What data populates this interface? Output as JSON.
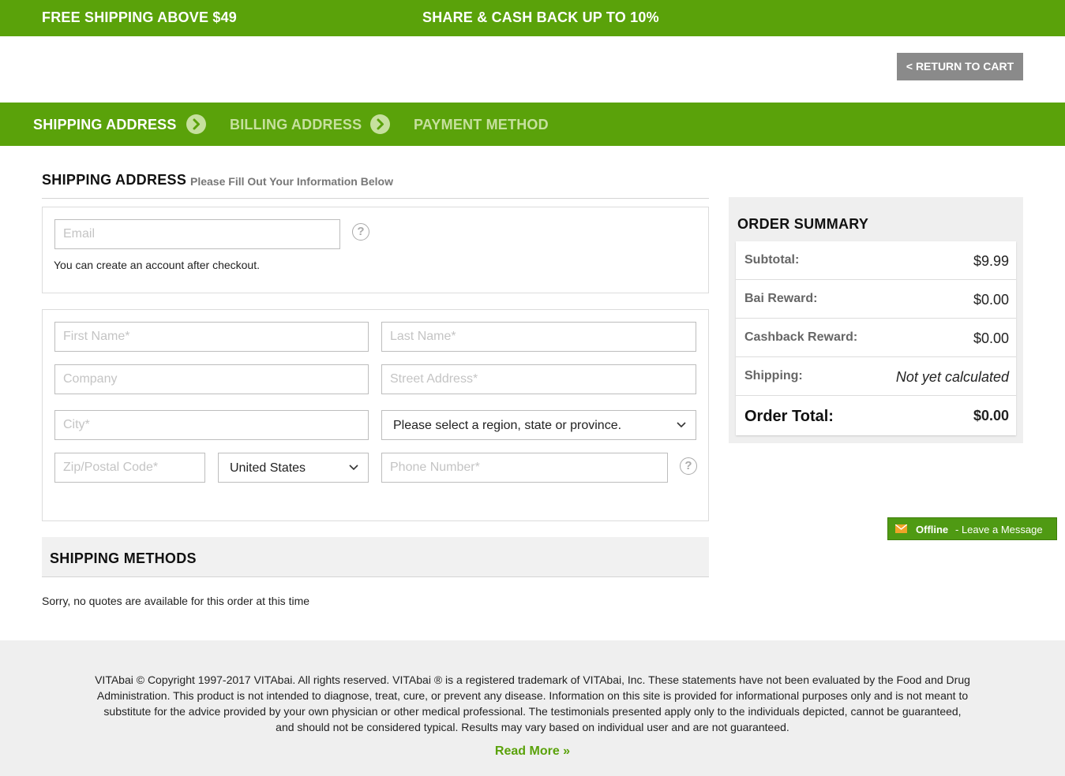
{
  "promo": {
    "left": "FREE SHIPPING ABOVE $49",
    "right": "SHARE & CASH BACK UP TO 10%"
  },
  "header": {
    "return_label": "< RETURN TO CART"
  },
  "steps": [
    {
      "label": "SHIPPING ADDRESS",
      "active": true
    },
    {
      "label": "BILLING ADDRESS",
      "active": false
    },
    {
      "label": "PAYMENT METHOD",
      "active": false
    }
  ],
  "shipping": {
    "title": "SHIPPING ADDRESS",
    "subtitle": "Please Fill Out Your Information Below",
    "email_placeholder": "Email",
    "account_note": "You can create an account after checkout.",
    "first_name_placeholder": "First Name*",
    "last_name_placeholder": "Last Name*",
    "company_placeholder": "Company",
    "street_placeholder": "Street Address*",
    "city_placeholder": "City*",
    "region_selected": "Please select a region, state or province.",
    "zip_placeholder": "Zip/Postal Code*",
    "country_selected": "United States",
    "phone_placeholder": "Phone Number*",
    "help_glyph": "?"
  },
  "shipping_methods": {
    "title": "SHIPPING METHODS",
    "message": "Sorry, no quotes are available for this order at this time"
  },
  "summary": {
    "title": "ORDER SUMMARY",
    "rows": [
      {
        "label": "Subtotal:",
        "value": "$9.99"
      },
      {
        "label": "Bai Reward:",
        "value": "$0.00"
      },
      {
        "label": "Cashback Reward:",
        "value": "$0.00"
      },
      {
        "label": "Shipping:",
        "value": "Not yet calculated"
      },
      {
        "label": "Order Total:",
        "value": "$0.00"
      }
    ]
  },
  "chat": {
    "status": "Offline",
    "message": "- Leave a Message"
  },
  "footer": {
    "text": "VITAbai © Copyright 1997-2017 VITAbai. All rights reserved. VITAbai ® is a registered trademark of VITAbai, Inc.  These statements have not been evaluated by the Food and Drug Administration. This product is not intended to diagnose, treat, cure, or prevent any disease. Information on this site is provided for informational purposes only and is not meant to substitute for the advice provided by your own physician or other medical professional. The testimonials presented apply only to the individuals depicted, cannot be guaranteed, and should not be considered typical. Results may vary based on individual user and are not guaranteed.",
    "read_more": "Read More »"
  },
  "colors": {
    "brand_green": "#5aa20a",
    "inactive_step": "#c6e09e",
    "return_button": "#8a8a8a"
  }
}
